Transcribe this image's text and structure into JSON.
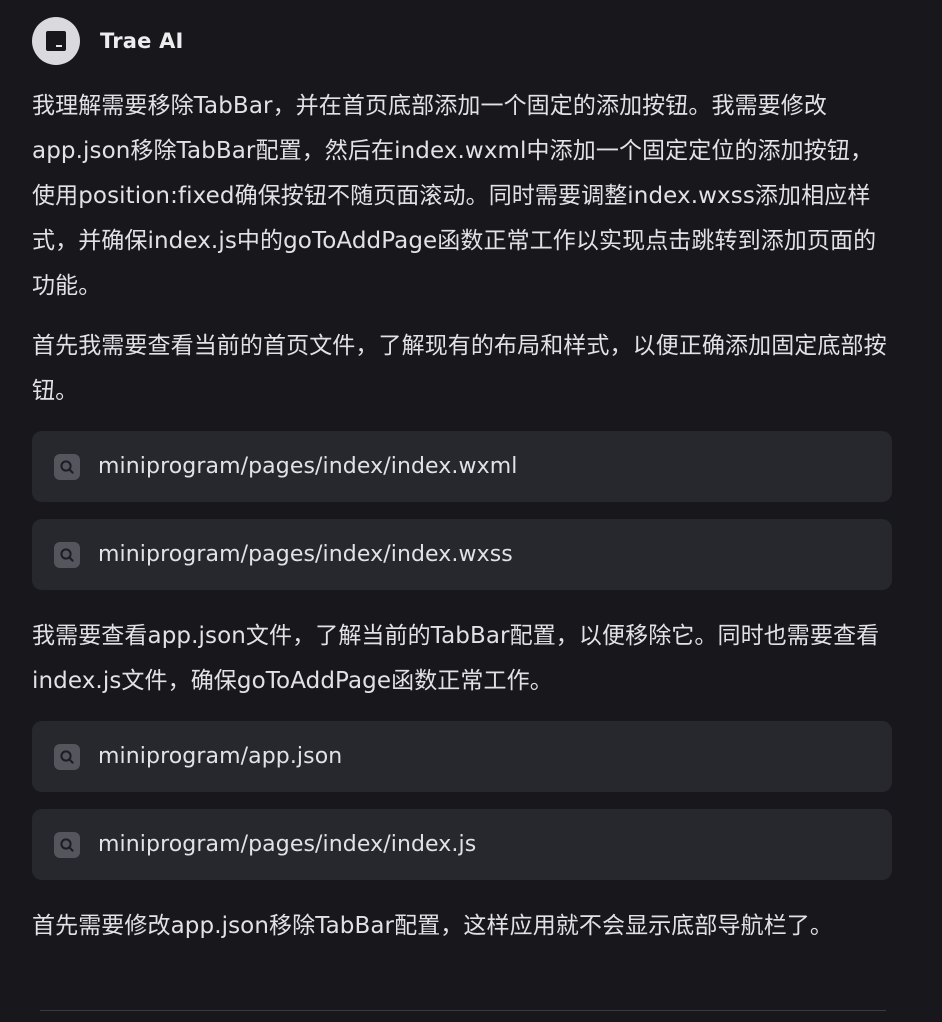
{
  "assistant": {
    "name": "Trae AI"
  },
  "messages": {
    "intro": "我理解需要移除TabBar，并在首页底部添加一个固定的添加按钮。我需要修改app.json移除TabBar配置，然后在index.wxml中添加一个固定定位的添加按钮，使用position:fixed确保按钮不随页面滚动。同时需要调整index.wxss添加相应样式，并确保index.js中的goToAddPage函数正常工作以实现点击跳转到添加页面的功能。",
    "check_home": "首先我需要查看当前的首页文件，了解现有的布局和样式，以便正确添加固定底部按钮。",
    "check_config": "我需要查看app.json文件，了解当前的TabBar配置，以便移除它。同时也需要查看index.js文件，确保goToAddPage函数正常工作。",
    "modify_config": "首先需要修改app.json移除TabBar配置，这样应用就不会显示底部导航栏了。"
  },
  "file_groups": {
    "home_files": [
      {
        "path": "miniprogram/pages/index/index.wxml",
        "icon": "search-icon"
      },
      {
        "path": "miniprogram/pages/index/index.wxss",
        "icon": "search-icon"
      }
    ],
    "config_files": [
      {
        "path": "miniprogram/app.json",
        "icon": "search-icon"
      },
      {
        "path": "miniprogram/pages/index/index.js",
        "icon": "search-icon"
      }
    ]
  },
  "colors": {
    "background": "#18181c",
    "chip_background": "#27272e",
    "text": "#e2e2e6",
    "icon_badge": "#55555e"
  }
}
